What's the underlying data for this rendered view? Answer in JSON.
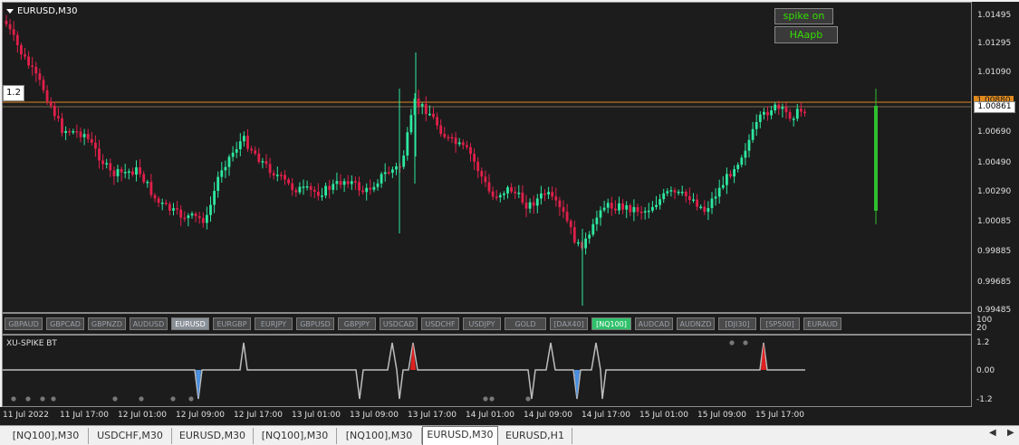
{
  "chart": {
    "title": "EURUSD,M30",
    "buttons": {
      "spike_label": "spike on",
      "haapb_label": "HAapb"
    },
    "level_label": "1.2",
    "current_price": "1.00861",
    "overlap_price": "1.00880",
    "price_axis": [
      "1.01495",
      "1.01295",
      "1.01090",
      "1.00890",
      "1.00690",
      "1.00490",
      "1.00290",
      "1.00085",
      "0.99885",
      "0.99685",
      "0.99485"
    ],
    "colors": {
      "bull": "#2ee8a0",
      "bear": "#e0204a",
      "level_line": "#e08a1e",
      "spike_bar": "#2fbf2f"
    }
  },
  "symbols": [
    "GBPAUD",
    "GBPCAD",
    "GBPNZD",
    "AUDUSD",
    "EURUSD",
    "EURGBP",
    "EURJPY",
    "GBPUSD",
    "GBPJPY",
    "USDCAD",
    "USDCHF",
    "USDJPY",
    "GOLD",
    "[DAX40]",
    "[NQ100]",
    "AUDCAD",
    "AUDNZD",
    "[DJI30]",
    "[SP500]",
    "EURAUD"
  ],
  "active_symbol": "EURUSD",
  "highlight_symbol": "[NQ100]",
  "indicator": {
    "title": "XU-SPIKE BT",
    "axis": [
      "100",
      "20",
      "1.2",
      "0.00",
      "-1.2"
    ]
  },
  "time_axis": [
    "11 Jul 2022",
    "11 Jul 17:00",
    "12 Jul 01:00",
    "12 Jul 09:00",
    "12 Jul 17:00",
    "13 Jul 01:00",
    "13 Jul 09:00",
    "13 Jul 17:00",
    "14 Jul 01:00",
    "14 Jul 09:00",
    "14 Jul 17:00",
    "15 Jul 01:00",
    "15 Jul 09:00",
    "15 Jul 17:00"
  ],
  "tabs": [
    "[NQ100],M30",
    "USDCHF,M30",
    "EURUSD,M30",
    "[NQ100],M30",
    "[NQ100],M30",
    "EURUSD,M30",
    "EURUSD,H1"
  ],
  "active_tab_index": 5,
  "icons": {
    "scroll_left": "triangle-left-icon",
    "scroll_right": "triangle-right-icon",
    "menu": "triangle-down-icon"
  }
}
